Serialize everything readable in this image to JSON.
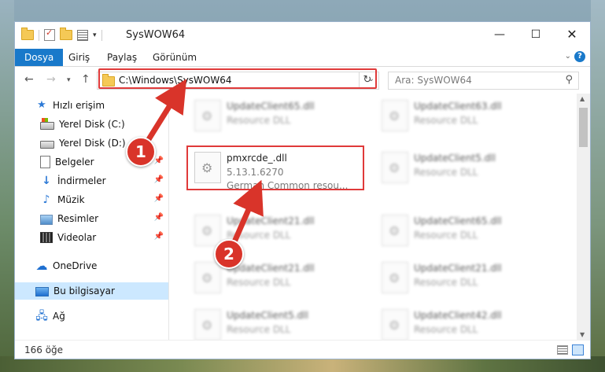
{
  "window": {
    "title": "SysWOW64"
  },
  "ribbon": {
    "tabs": [
      "Dosya",
      "Giriş",
      "Paylaş",
      "Görünüm"
    ]
  },
  "address": {
    "path": "C:\\Windows\\SysWOW64",
    "search_placeholder": "Ara: SysWOW64"
  },
  "sidebar": {
    "items": [
      {
        "label": "Hızlı erişim",
        "icon": "star-icon"
      },
      {
        "label": "Yerel Disk (C:)",
        "icon": "drive-icon"
      },
      {
        "label": "Yerel Disk (D:)",
        "icon": "drive-icon"
      },
      {
        "label": "Belgeler",
        "icon": "document-icon",
        "pinned": true
      },
      {
        "label": "İndirmeler",
        "icon": "download-icon",
        "pinned": true
      },
      {
        "label": "Müzik",
        "icon": "music-icon",
        "pinned": true
      },
      {
        "label": "Resimler",
        "icon": "pictures-icon",
        "pinned": true
      },
      {
        "label": "Videolar",
        "icon": "videos-icon",
        "pinned": true
      },
      {
        "label": "OneDrive",
        "icon": "onedrive-icon"
      },
      {
        "label": "Bu bilgisayar",
        "icon": "this-pc-icon",
        "selected": true
      },
      {
        "label": "Ağ",
        "icon": "network-icon"
      }
    ]
  },
  "files": {
    "left": [
      {
        "name": "UpdateClient65.dll",
        "type": "Resource DLL"
      },
      {
        "name": "pmxrcde_.dll",
        "version": "5.13.1.6270",
        "description": "German Common resou..."
      },
      {
        "name": "UpdateClient21.dll",
        "type": "Resource DLL"
      },
      {
        "name": "UpdateClient21.dll",
        "type": "Resource DLL"
      },
      {
        "name": "UpdateClient5.dll",
        "type": "Resource DLL"
      }
    ],
    "right": [
      {
        "name": "UpdateClient63.dll",
        "type": "Resource DLL"
      },
      {
        "name": "UpdateClient5.dll",
        "type": "Resource DLL"
      },
      {
        "name": "UpdateClient65.dll",
        "type": "Resource DLL"
      },
      {
        "name": "UpdateClient21.dll",
        "type": "Resource DLL"
      },
      {
        "name": "UpdateClient42.dll",
        "type": "Resource DLL"
      }
    ]
  },
  "status": {
    "count": "166 öğe"
  },
  "annotations": {
    "step1": "1",
    "step2": "2",
    "highlight_color": "#e03a3a"
  },
  "colors": {
    "accent": "#1979ca",
    "selected_bg": "#cce8ff"
  }
}
